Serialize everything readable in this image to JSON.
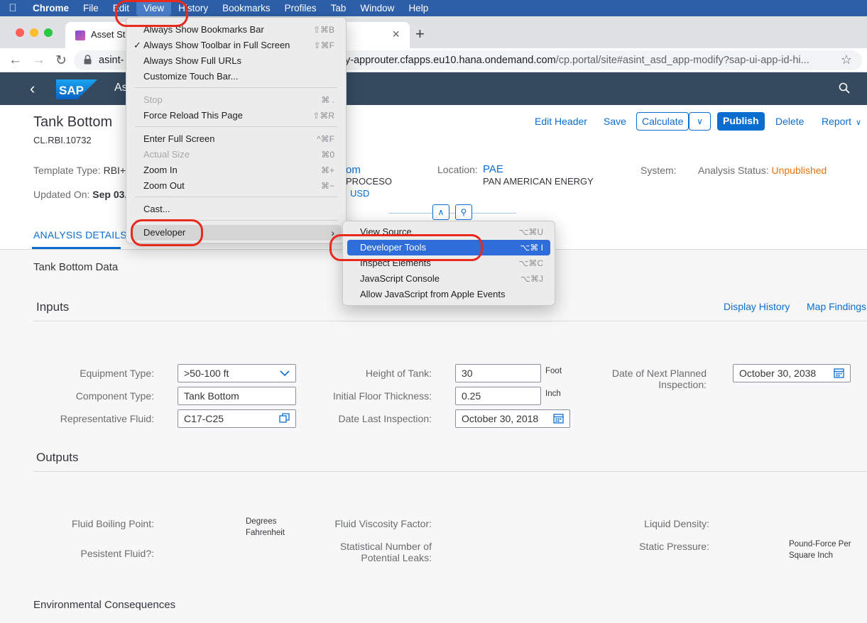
{
  "menubar": {
    "items": [
      "Chrome",
      "File",
      "Edit",
      "View",
      "History",
      "Bookmarks",
      "Profiles",
      "Tab",
      "Window",
      "Help"
    ]
  },
  "browser": {
    "tab_title": "Asset St",
    "url_left": "asint-",
    "url_host": "ty-approuter.cfapps.eu10.hana.ondemand.com",
    "url_rest": "/cp.portal/site#asint_asd_app-modify?sap-ui-app-id-hi..."
  },
  "shell": {
    "app_title": "As"
  },
  "header": {
    "title": "Tank Bottom",
    "subtitle": "CL.RBI.10732",
    "template_label": "Template Type:",
    "template_value": "RBI+",
    "updated_label": "Updated On:",
    "updated_value": "Sep 03,",
    "mid_link": "om",
    "mid_line2": "PROCESO",
    "mid_line3": "USD",
    "location_label": "Location:",
    "location_value": "PAE",
    "location_sub": "PAN AMERICAN ENERGY",
    "system_label": "System:",
    "status_label": "Analysis Status:",
    "status_value": "Unpublished",
    "actions": {
      "edit_header": "Edit Header",
      "save": "Save",
      "calculate": "Calculate",
      "publish": "Publish",
      "delete": "Delete",
      "report": "Report"
    },
    "tab": "ANALYSIS DETAILS"
  },
  "content": {
    "section_title": "Tank Bottom Data",
    "inputs": {
      "title": "Inputs",
      "display_history": "Display History",
      "map_findings": "Map Findings",
      "equipment_type_label": "Equipment Type:",
      "equipment_type_value": ">50-100 ft",
      "component_type_label": "Component Type:",
      "component_type_value": "Tank Bottom",
      "rep_fluid_label": "Representative Fluid:",
      "rep_fluid_value": "C17-C25",
      "height_label": "Height of Tank:",
      "height_value": "30",
      "height_unit": "Foot",
      "floor_label": "Initial Floor Thickness:",
      "floor_value": "0.25",
      "floor_unit": "Inch",
      "last_insp_label": "Date Last Inspection:",
      "last_insp_value": "October 30, 2018",
      "next_insp_label_1": "Date of Next Planned",
      "next_insp_label_2": "Inspection:",
      "next_insp_value": "October 30, 2038"
    },
    "outputs": {
      "title": "Outputs",
      "boiling_label": "Fluid Boiling Point:",
      "boiling_unit_1": "Degrees",
      "boiling_unit_2": "Fahrenheit",
      "persistent_label": "Pesistent Fluid?:",
      "viscosity_label": "Fluid Viscosity Factor:",
      "leaks_label_1": "Statistical Number of",
      "leaks_label_2": "Potential Leaks:",
      "density_label": "Liquid Density:",
      "pressure_label": "Static Pressure:",
      "pressure_unit_1": "Pound-Force Per",
      "pressure_unit_2": "Square Inch"
    },
    "env_title": "Environmental Consequences"
  },
  "view_menu": {
    "items": [
      {
        "label": "Always Show Bookmarks Bar",
        "shortcut": "⇧⌘B"
      },
      {
        "label": "Always Show Toolbar in Full Screen",
        "shortcut": "⇧⌘F",
        "checked": "✓"
      },
      {
        "label": "Always Show Full URLs",
        "shortcut": ""
      },
      {
        "label": "Customize Touch Bar...",
        "shortcut": ""
      },
      {
        "label": "Stop",
        "shortcut": "⌘ ."
      },
      {
        "label": "Force Reload This Page",
        "shortcut": "⇧⌘R"
      },
      {
        "label": "Enter Full Screen",
        "shortcut": "^⌘F"
      },
      {
        "label": "Actual Size",
        "shortcut": "⌘0"
      },
      {
        "label": "Zoom In",
        "shortcut": "⌘+"
      },
      {
        "label": "Zoom Out",
        "shortcut": "⌘−"
      },
      {
        "label": "Cast...",
        "shortcut": ""
      },
      {
        "label": "Developer",
        "shortcut": ""
      }
    ]
  },
  "developer_menu": {
    "items": [
      {
        "label": "View Source",
        "shortcut": "⌥⌘U"
      },
      {
        "label": "Developer Tools",
        "shortcut": "⌥⌘ I"
      },
      {
        "label": "Inspect Elements",
        "shortcut": "⌥⌘C"
      },
      {
        "label": "JavaScript Console",
        "shortcut": "⌥⌘J"
      },
      {
        "label": "Allow JavaScript from Apple Events",
        "shortcut": ""
      }
    ]
  },
  "colors": {
    "menubar": "#2d5fa8",
    "shell": "#354a5f",
    "accent": "#0a6ed1",
    "status_warning": "#e9730c",
    "highlight": "#2f6ddb",
    "annotation_ring": "#e8291c"
  },
  "icons": [
    "apple-icon",
    "back-arrow-icon",
    "forward-arrow-icon",
    "reload-icon",
    "lock-icon",
    "star-icon",
    "sap-logo",
    "search-icon",
    "chevron-down-icon",
    "calendar-icon",
    "value-help-icon",
    "pin-icon",
    "collapse-icon",
    "submenu-arrow-icon",
    "checkmark-icon"
  ]
}
